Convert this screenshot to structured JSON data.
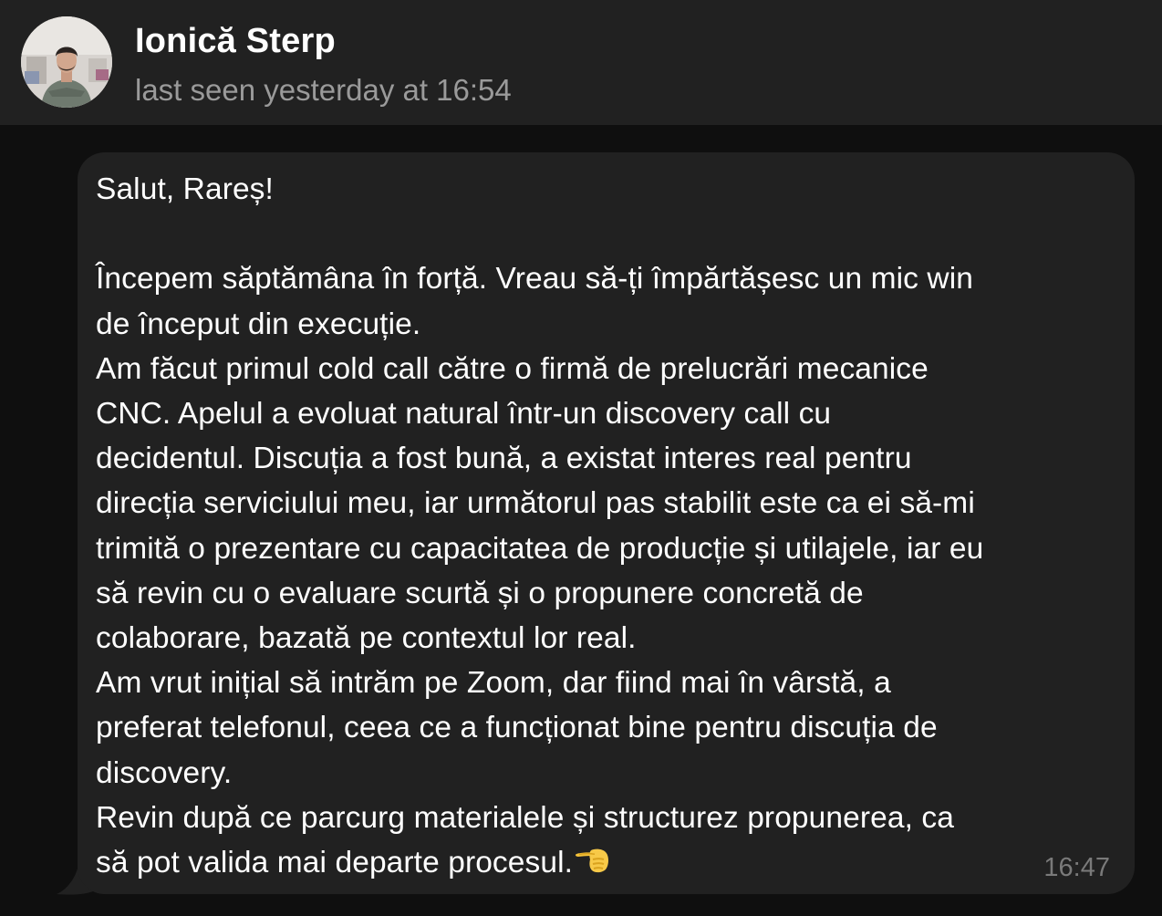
{
  "header": {
    "contact_name": "Ionică Sterp",
    "status": "last seen yesterday at 16:54",
    "avatar_icon": "profile-photo"
  },
  "message": {
    "text": "Salut, Rareș!\n\nÎncepem săptămâna în forță. Vreau să-ți împărtășesc un mic win\nde început din execuție.\nAm făcut primul cold call către o firmă de prelucrări mecanice\nCNC. Apelul a evoluat natural într-un discovery call cu\ndecidentul. Discuția a fost bună, a existat interes real pentru\ndirecția serviciului meu, iar următorul pas stabilit este ca ei să-mi\ntrimită o prezentare cu capacitatea de producție și utilajele, iar eu\nsă revin cu o evaluare scurtă și o propunere concretă de\ncolaborare, bazată pe contextul lor real.\nAm vrut inițial să intrăm pe Zoom, dar fiind mai în vârstă, a\npreferat telefonul, ceea ce a funcționat bine pentru discuția de\ndiscovery.\nRevin după ce parcurg materialele și structurez propunerea, ca\nsă pot valida mai departe procesul.",
    "emoji": "pointing-hand-emoji",
    "time": "16:47"
  },
  "colors": {
    "header_bg": "#212121",
    "chat_bg": "#0f0f0f",
    "bubble_bg": "#212121",
    "secondary_text": "#9a9a9a",
    "time_text": "#7a7a7a"
  }
}
